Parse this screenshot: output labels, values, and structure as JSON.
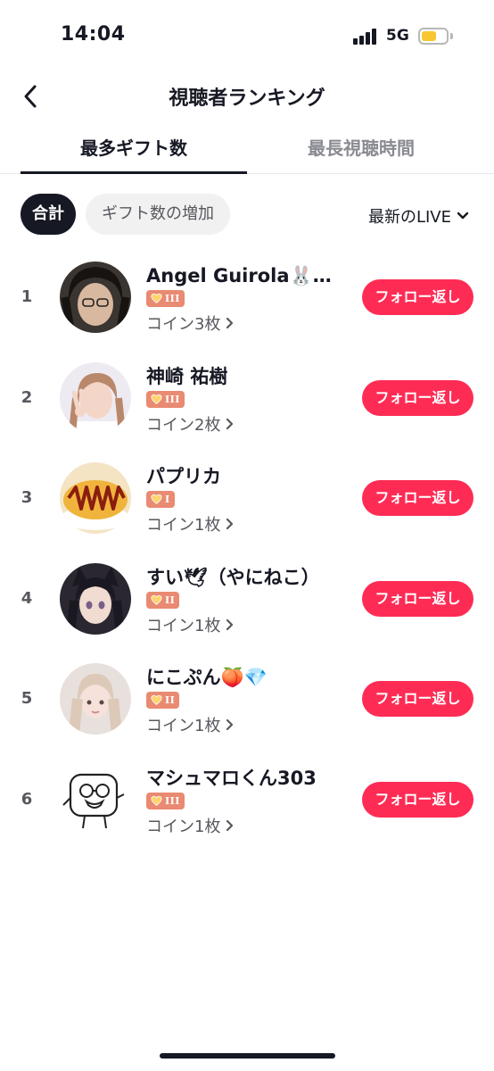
{
  "status_bar": {
    "time": "14:04",
    "network": "5G",
    "battery_level": 0.62
  },
  "header": {
    "title": "視聴者ランキング",
    "back_icon": "chevron-left-icon"
  },
  "tabs": [
    {
      "label": "最多ギフト数",
      "active": true
    },
    {
      "label": "最長視聴時間",
      "active": false
    }
  ],
  "filters": {
    "chips": [
      {
        "label": "合計",
        "selected": true
      },
      {
        "label": "ギフト数の増加",
        "selected": false
      }
    ],
    "sort_label": "最新のLIVE",
    "sort_icon": "chevron-down-icon"
  },
  "ranking": [
    {
      "rank": "1",
      "name": "Angel Guirola🐰🍀…",
      "level": "III",
      "coins": "コイン3枚",
      "button": "フォロー返し",
      "avatar": "avatar-curly-hair"
    },
    {
      "rank": "2",
      "name": "神崎 祐樹",
      "level": "III",
      "coins": "コイン2枚",
      "button": "フォロー返し",
      "avatar": "avatar-peace-sign"
    },
    {
      "rank": "3",
      "name": "パプリカ",
      "level": "I",
      "coins": "コイン1枚",
      "button": "フォロー返し",
      "avatar": "avatar-omurice"
    },
    {
      "rank": "4",
      "name": "すい🕊（やにねこ）",
      "level": "II",
      "coins": "コイン1枚",
      "button": "フォロー返し",
      "avatar": "avatar-cat-ears"
    },
    {
      "rank": "5",
      "name": "にこぷん🍑💎",
      "level": "II",
      "coins": "コイン1枚",
      "button": "フォロー返し",
      "avatar": "avatar-blonde-girl"
    },
    {
      "rank": "6",
      "name": "マシュマロくん303",
      "level": "III",
      "coins": "コイン1枚",
      "button": "フォロー返し",
      "avatar": "avatar-marshmallow-drawing"
    }
  ],
  "colors": {
    "accent": "#fe2c55",
    "badge": "#e98a72",
    "text_primary": "#161823",
    "text_secondary": "#57585e"
  }
}
